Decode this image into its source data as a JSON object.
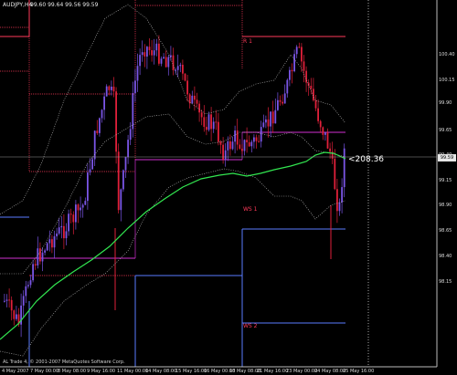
{
  "header": {
    "symbol_timeframe": "AUDJPY,H4",
    "ohlc": "99.60 99.64 99.56 99.59"
  },
  "price_axis": {
    "labels": [
      "100.40",
      "100.15",
      "99.90",
      "99.65",
      "99.40",
      "99.15",
      "98.90",
      "98.65",
      "98.40",
      "98.15"
    ],
    "current_price": "99.59"
  },
  "time_axis": {
    "labels": [
      "4 May 2007",
      "7 May 00:00",
      "8 May 08:00",
      "9 May 16:00",
      "11 May 00:00",
      "14 May 08:00",
      "15 May 16:00",
      "16 May 00:00",
      "18 May 08:00",
      "21 May 16:00",
      "23 May 00:00",
      "24 May 08:00",
      "25 May 16:00"
    ]
  },
  "levels": {
    "r1_label": "R 1",
    "s1_label": "WS 1",
    "s2_label": "WS 2",
    "pivot_tag": "<208.36"
  },
  "footer": {
    "copyright": "AL Trade 4, © 2001-2007 MetaQuotes Software Corp."
  },
  "colors": {
    "background": "#000000",
    "bull_candle": "#7a55e6",
    "bear_candle": "#e0203a",
    "moving_average": "#32e650",
    "bands": "#c8c8c8",
    "r_level": "#ff3a5a",
    "s_level": "#5a7cff",
    "pivot": "#d030d0",
    "grid": "#5a5a5a"
  }
}
